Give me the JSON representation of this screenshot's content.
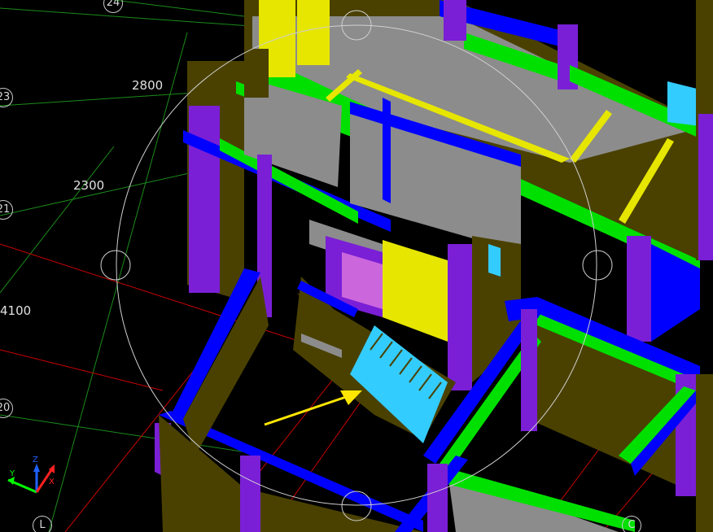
{
  "grid": {
    "axes": [
      {
        "id": "axis-24",
        "label": "24"
      },
      {
        "id": "axis-23",
        "label": "23"
      },
      {
        "id": "axis-21",
        "label": "21"
      },
      {
        "id": "axis-20",
        "label": "20"
      },
      {
        "id": "axis-l",
        "label": "L"
      },
      {
        "id": "axis-c",
        "label": "C"
      }
    ],
    "dimensions": [
      {
        "id": "dim-2800",
        "label": "2800"
      },
      {
        "id": "dim-2300",
        "label": "2300"
      },
      {
        "id": "dim-4100",
        "label": "4100"
      }
    ]
  },
  "colors": {
    "background": "#000000",
    "wall": "#4a4100",
    "column": "#7a1fd6",
    "beam_blue": "#0000ff",
    "beam_green": "#00e000",
    "slab": "#8c8c8c",
    "yellow": "#e6e600",
    "stair": "#33ccff",
    "pink": "#cc66dd",
    "grid_green": "#1a8c1a",
    "grid_red": "#cc0000",
    "arrow": "#ffe600"
  },
  "orbit_circle": {
    "visible": true
  },
  "annotation": {
    "arrow_icon": "yellow-arrow-icon"
  },
  "ucs": {
    "icon": "ucs-axes-icon",
    "labels": [
      "Y",
      "X",
      "Z"
    ]
  }
}
